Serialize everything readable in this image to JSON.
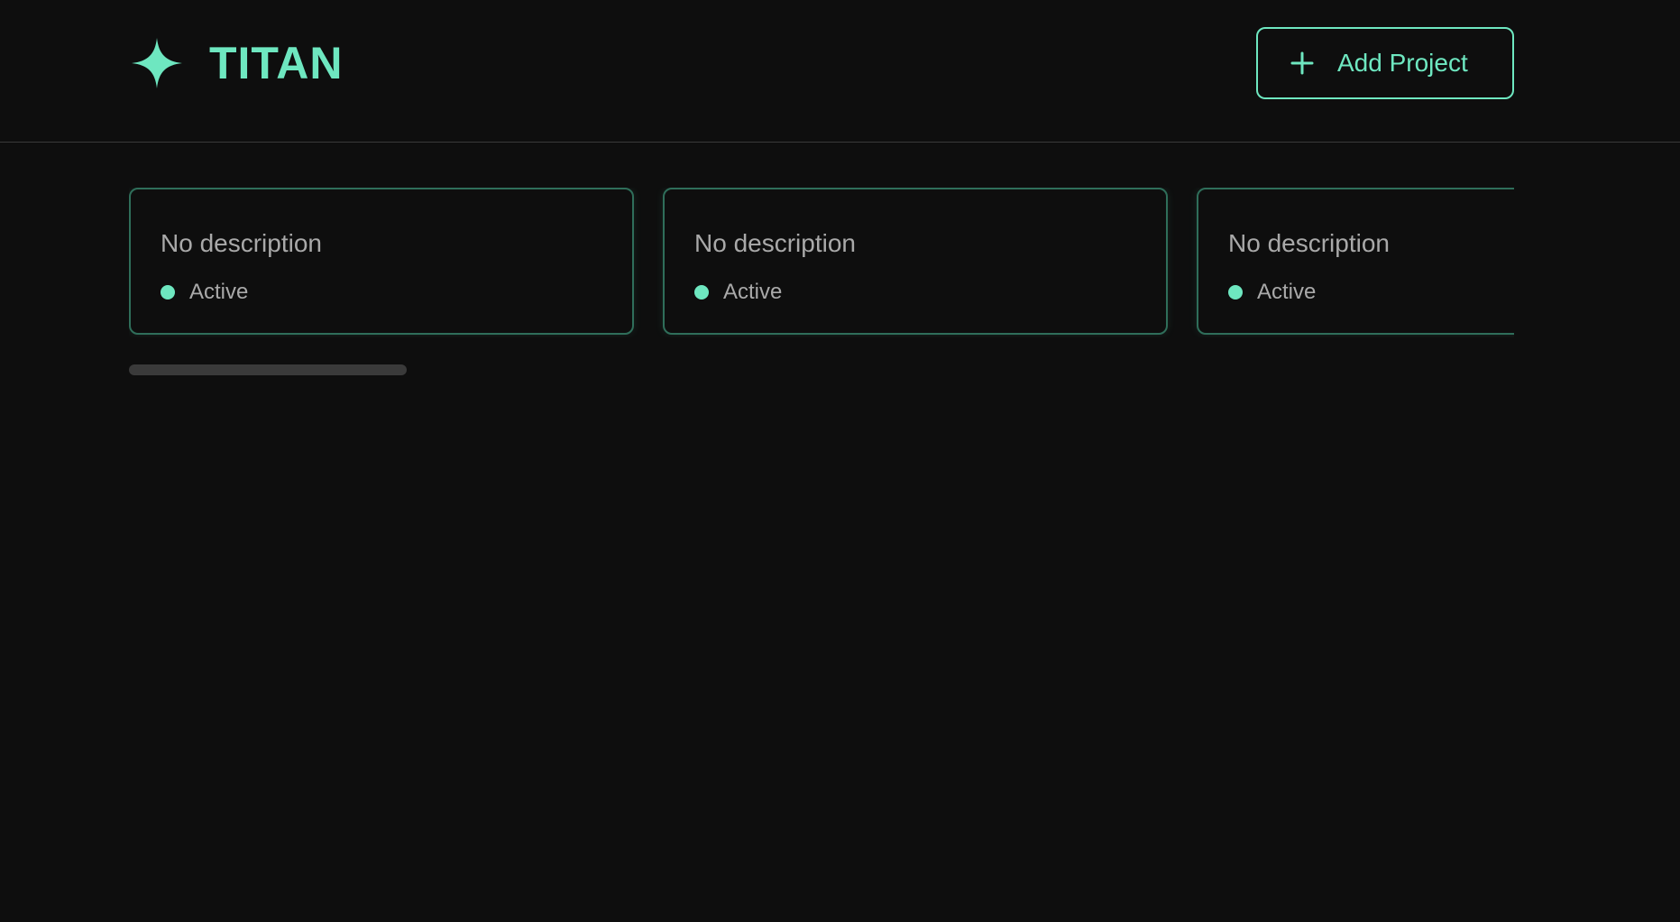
{
  "app": {
    "name": "TITAN",
    "logo_icon": "sparkle-icon",
    "accent_color": "#6ee7c0"
  },
  "header": {
    "add_project_label": "Add Project",
    "add_project_icon": "plus-icon"
  },
  "projects": [
    {
      "description": "No description",
      "status": "Active"
    },
    {
      "description": "No description",
      "status": "Active"
    },
    {
      "description": "No description",
      "status": "Active"
    }
  ]
}
